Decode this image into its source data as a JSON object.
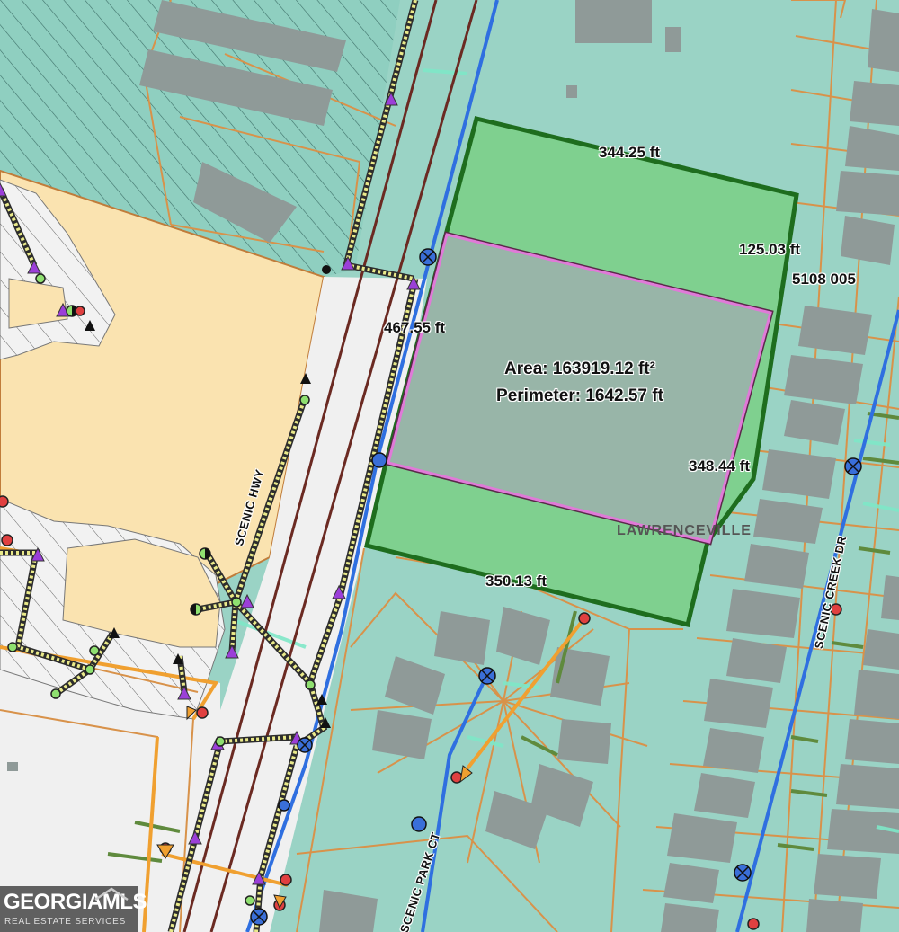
{
  "measurements": {
    "top_edge": "344.25 ft",
    "right_top_edge": "125.03 ft",
    "left_edge": "467.55 ft",
    "right_edge": "348.44 ft",
    "bottom_edge": "350.13 ft"
  },
  "selection": {
    "area": "Area: 163919.12 ft²",
    "perimeter": "Perimeter: 1642.57 ft"
  },
  "parcel_id": "5108 005",
  "streets": {
    "scenic_hwy": "SCENIC HWY",
    "scenic_creek_dr": "SCENIC CREEK DR",
    "scenic_park_ct": "SCENIC PARK CT"
  },
  "city_label": "LAWRENCEVILLE",
  "logo": {
    "brand": "GEORGIAMLS",
    "subtitle": "REAL ESTATE SERVICES"
  },
  "colors": {
    "base": "#9ad3c5",
    "parcel_line": "#d8924a",
    "building": "#8f9a98",
    "commercial_fill": "#fae3b0",
    "measured_parcel_fill": "#7fd08f",
    "measured_parcel_outline": "#1e6d1e",
    "selection_fill": "#98b5a8",
    "selection_outline": "#e07ad8",
    "water_main": "#2f6fe0",
    "sewer_line": "#eaea8a",
    "rail_line": "#6b2a22"
  },
  "icons": [
    "valve-icon",
    "hydrant-icon",
    "manhole-icon",
    "flow-arrow-icon"
  ]
}
